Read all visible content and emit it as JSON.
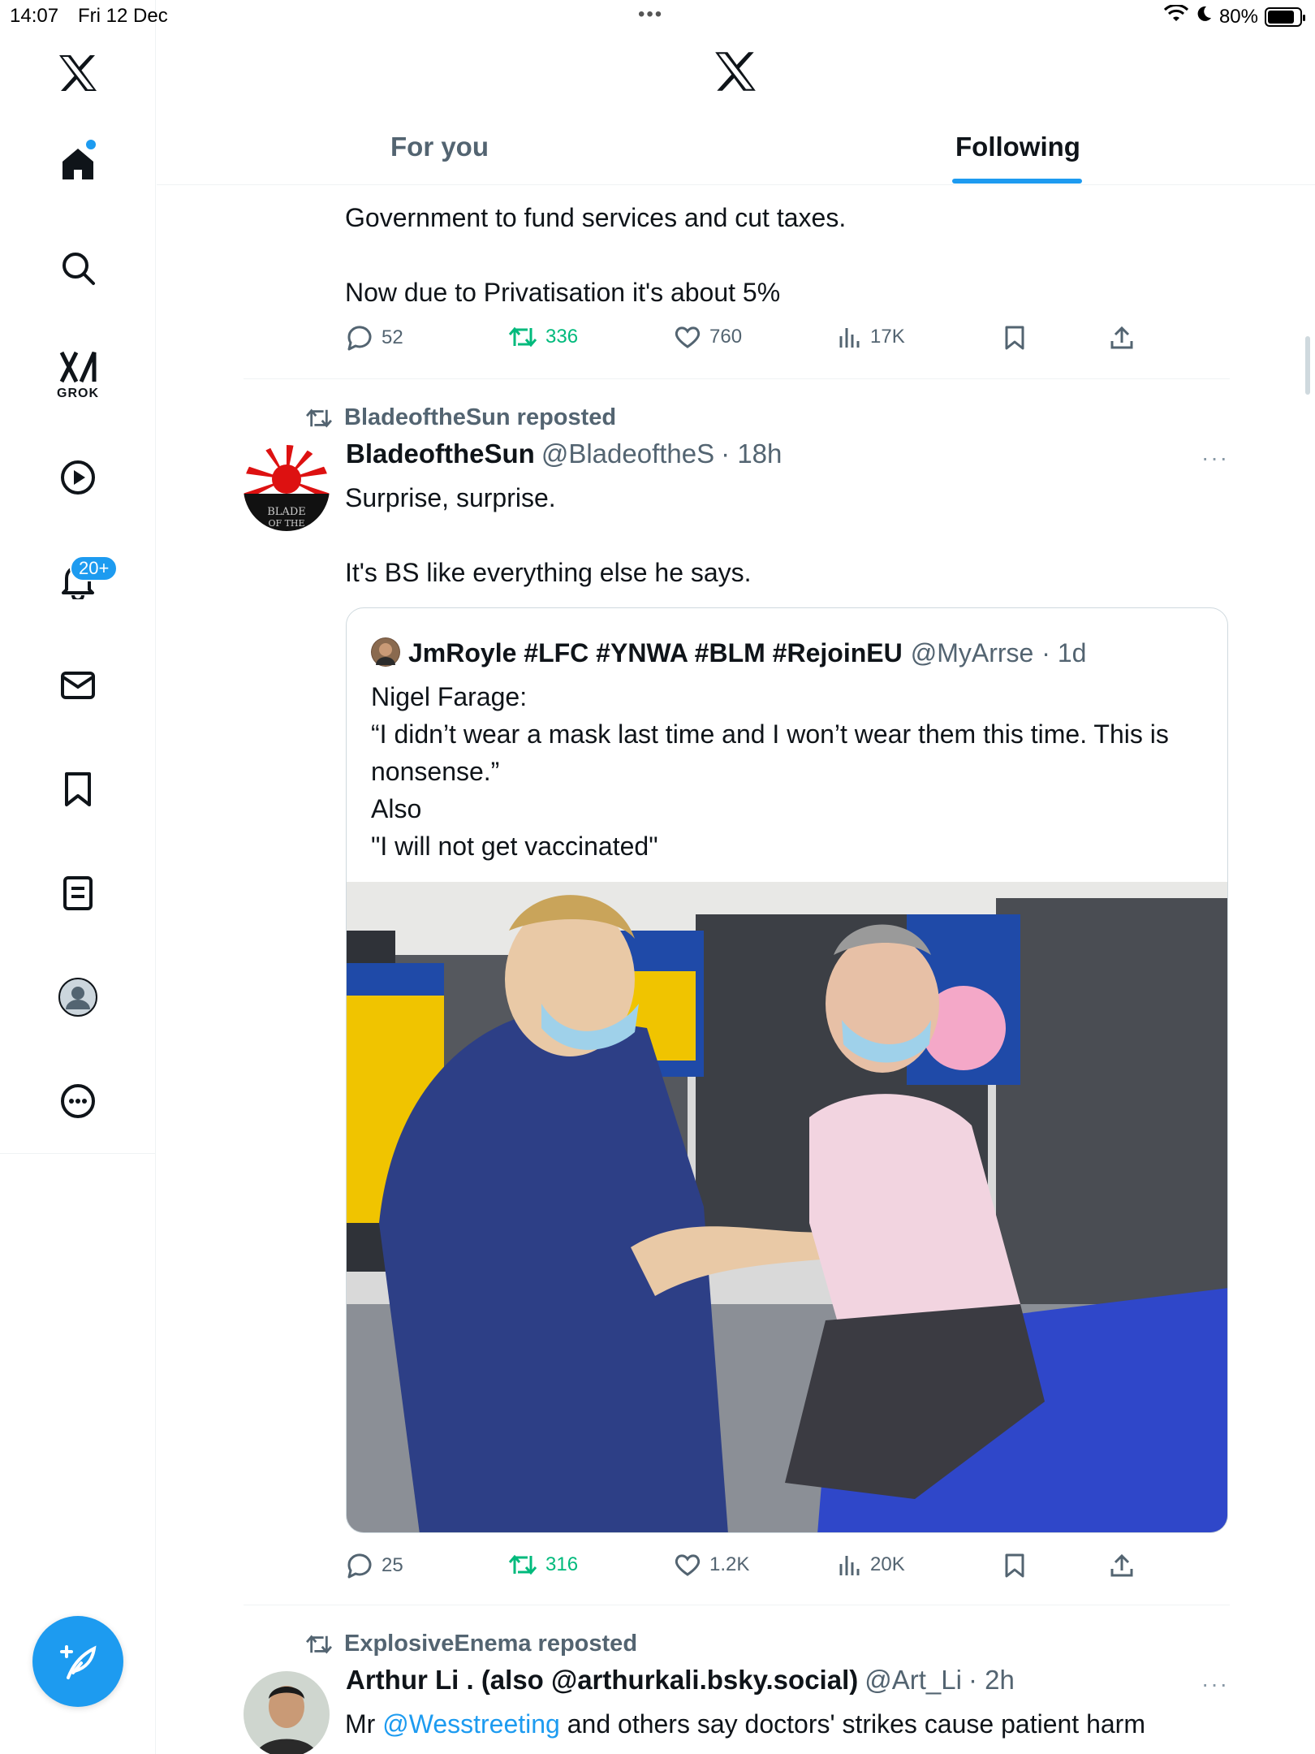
{
  "status_bar": {
    "time": "14:07",
    "date": "Fri 12 Dec",
    "battery": "80%"
  },
  "sidebar": {
    "notifications_badge": "20+",
    "grok_label": "GROK"
  },
  "header": {
    "tabs": [
      {
        "label": "For you"
      },
      {
        "label": "Following"
      }
    ]
  },
  "tweets": [
    {
      "text_lines": [
        "Government to fund services and cut taxes.",
        "Now due to Privatisation it's about 5%"
      ],
      "replies": "52",
      "reposts": "336",
      "likes": "760",
      "views": "17K"
    },
    {
      "repost_by": "BladeoftheSun reposted",
      "name": "BladeoftheSun",
      "handle": "@BladeoftheS",
      "time": "· 18h",
      "more": "···",
      "text_lines": [
        "Surprise, surprise.",
        "It's BS like everything else he says."
      ],
      "quote": {
        "name": "JmRoyle #LFC #YNWA #BLM #RejoinEU",
        "handle": "@MyArrse",
        "time": "· 1d",
        "text_lines": [
          "Nigel Farage:",
          "“I didn’t wear a mask last time and I won’t wear them this time. This is nonsense.”",
          "Also",
          "\"I will not get vaccinated\""
        ]
      },
      "replies": "25",
      "reposts": "316",
      "likes": "1.2K",
      "views": "20K"
    },
    {
      "repost_by": "ExplosiveEnema reposted",
      "name": "Arthur Li . (also @arthurkali.bsky.social)",
      "handle": "@Art_Li",
      "time": "· 2h",
      "more": "···",
      "text_prefix": "Mr ",
      "text_mention": "@Wesstreeting",
      "text_suffix": " and others say doctors' strikes cause patient harm"
    }
  ]
}
